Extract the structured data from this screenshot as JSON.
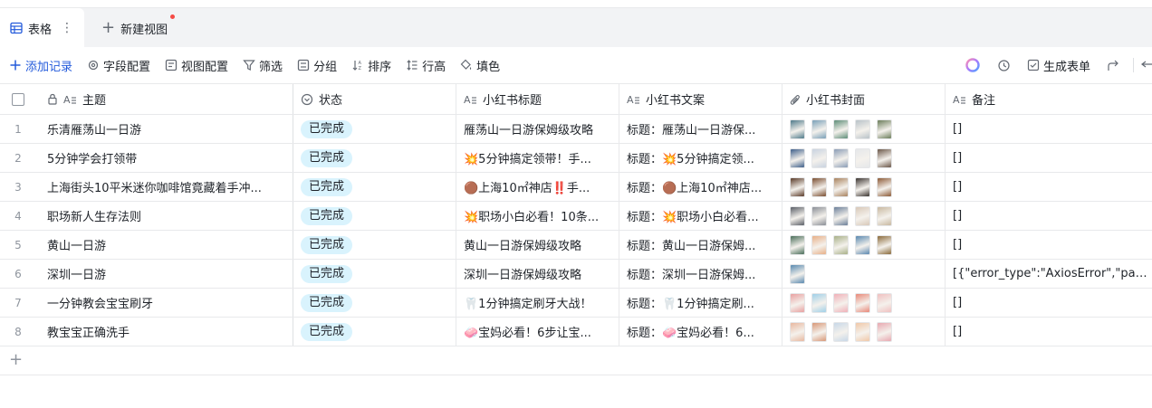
{
  "tabs": {
    "active_label": "表格",
    "new_view_label": "新建视图"
  },
  "toolbar": {
    "add_record": "添加记录",
    "field_config": "字段配置",
    "view_config": "视图配置",
    "filter": "筛选",
    "group": "分组",
    "sort": "排序",
    "row_height": "行高",
    "fill_color": "填色",
    "generate_form": "生成表单"
  },
  "columns": [
    {
      "key": "title",
      "label": "主题",
      "icon": "text-icon"
    },
    {
      "key": "status",
      "label": "状态",
      "icon": "status-icon"
    },
    {
      "key": "xhs_title",
      "label": "小红书标题",
      "icon": "text-icon"
    },
    {
      "key": "xhs_copy",
      "label": "小红书文案",
      "icon": "text-icon"
    },
    {
      "key": "xhs_cover",
      "label": "小红书封面",
      "icon": "attachment-icon"
    },
    {
      "key": "note",
      "label": "备注",
      "icon": "text-icon"
    }
  ],
  "rows": [
    {
      "idx": "1",
      "title": "乐清雁荡山一日游",
      "status": "已完成",
      "xhs_title": "雁荡山一日游保姆级攻略",
      "xhs_copy": "标题：雁荡山一日游保...",
      "covers": [
        "#4f7a8a",
        "#7aa0b8",
        "#5e8d78",
        "#b8c2c8",
        "#6b7d5a"
      ],
      "note": "[]"
    },
    {
      "idx": "2",
      "title": "5分钟学会打领带",
      "status": "已完成",
      "xhs_title": "💥5分钟搞定领带！手...",
      "xhs_copy": "标题：💥5分钟搞定领...",
      "covers": [
        "#3e5f8a",
        "#c9d3e0",
        "#8a9cb5",
        "#e5e7ea",
        "#6a5648"
      ],
      "note": "[]"
    },
    {
      "idx": "3",
      "title": "上海街头10平米迷你咖啡馆竟藏着手冲...",
      "status": "已完成",
      "xhs_title": "🟤上海10㎡神店‼️手...",
      "xhs_copy": "标题：🟤上海10㎡神店...",
      "covers": [
        "#5a3a28",
        "#7a4e30",
        "#a8825e",
        "#3b3430",
        "#8c5a36"
      ],
      "note": "[]"
    },
    {
      "idx": "4",
      "title": "职场新人生存法则",
      "status": "已完成",
      "xhs_title": "💥职场小白必看！10条...",
      "xhs_copy": "标题：💥职场小白必看...",
      "covers": [
        "#5a5e66",
        "#8a8e96",
        "#6b7f99",
        "#d8c8b8",
        "#c8b8a0"
      ],
      "note": "[]"
    },
    {
      "idx": "5",
      "title": "黄山一日游",
      "status": "已完成",
      "xhs_title": "黄山一日游保姆级攻略",
      "xhs_copy": "标题：黄山一日游保姆...",
      "covers": [
        "#4a6e5a",
        "#e8b088",
        "#a8b088",
        "#5a88b0",
        "#8a6a3a"
      ],
      "note": "[]"
    },
    {
      "idx": "6",
      "title": "深圳一日游",
      "status": "已完成",
      "xhs_title": "深圳一日游保姆级攻略",
      "xhs_copy": "标题：深圳一日游保姆...",
      "covers": [
        "#5a8ab0"
      ],
      "note": "[{\"error_type\":\"AxiosError\",\"page_i..."
    },
    {
      "idx": "7",
      "title": "一分钟教会宝宝刷牙",
      "status": "已完成",
      "xhs_title": "🦷1分钟搞定刷牙大战！",
      "xhs_copy": "标题：🦷1分钟搞定刷...",
      "covers": [
        "#e8a0a0",
        "#a0d0e8",
        "#f0b0b8",
        "#e88878",
        "#f0c0c0"
      ],
      "note": "[]"
    },
    {
      "idx": "8",
      "title": "教宝宝正确洗手",
      "status": "已完成",
      "xhs_title": "🧼宝妈必看！6步让宝...",
      "xhs_copy": "标题：🧼宝妈必看！6...",
      "covers": [
        "#e8b8a0",
        "#d89878",
        "#c8d8e8",
        "#f0c8a8",
        "#e8a8b0"
      ],
      "note": "[]"
    }
  ]
}
